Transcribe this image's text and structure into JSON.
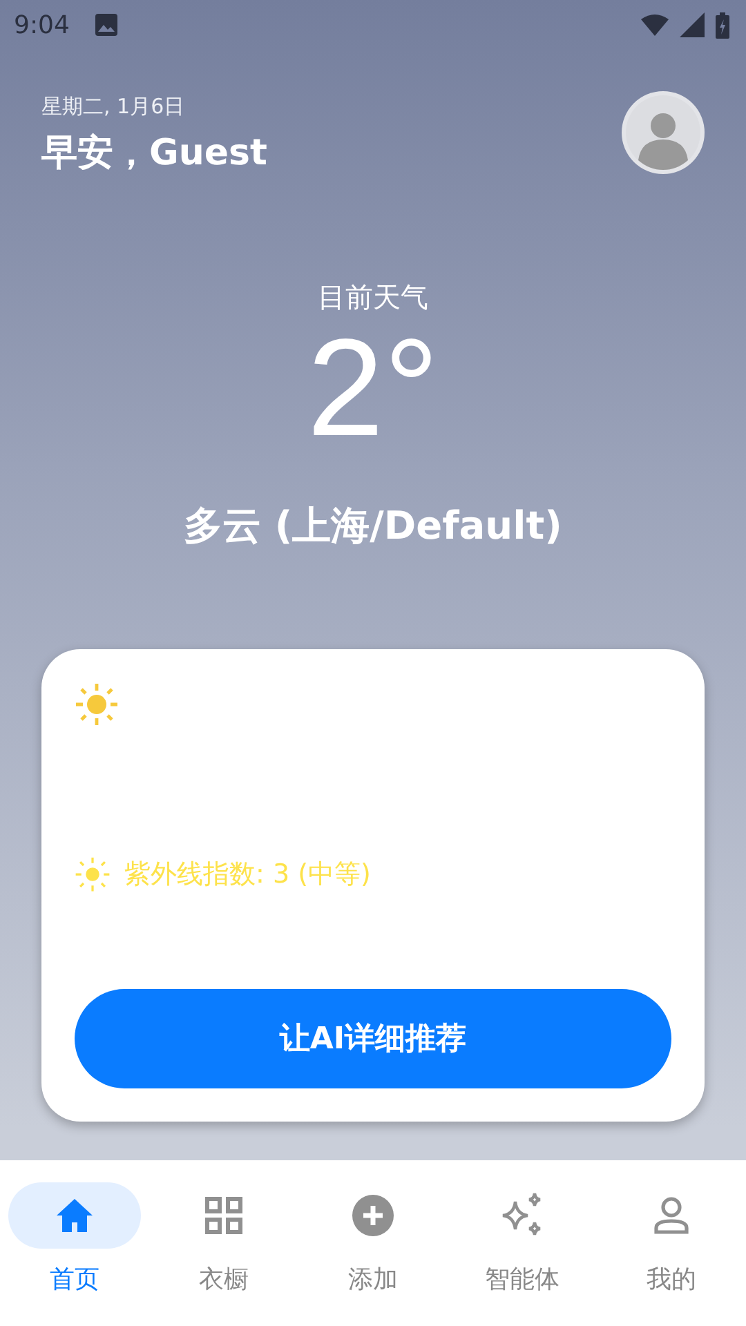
{
  "status_bar": {
    "time": "9:04"
  },
  "header": {
    "date": "星期二, 1月6日",
    "greeting": "早安，Guest"
  },
  "weather": {
    "label": "目前天气",
    "temperature": "2°",
    "condition": "多云 (上海/Default)"
  },
  "card": {
    "uv_index": "紫外线指数: 3 (中等)",
    "button": "让AI详细推荐"
  },
  "nav": [
    {
      "kind": "home",
      "label": "首页",
      "selected": true
    },
    {
      "kind": "grid",
      "label": "衣橱",
      "selected": false
    },
    {
      "kind": "add",
      "label": "添加",
      "selected": false
    },
    {
      "kind": "sparkle",
      "label": "智能体",
      "selected": false
    },
    {
      "kind": "person",
      "label": "我的",
      "selected": false
    }
  ]
}
